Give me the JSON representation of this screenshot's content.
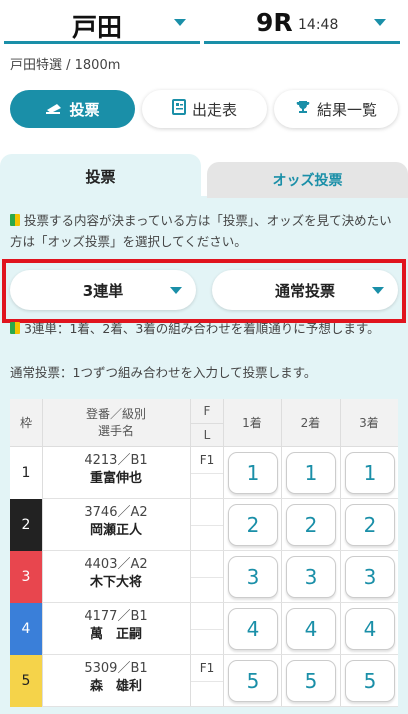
{
  "header": {
    "venue": "戸田",
    "race": "9R",
    "time": "14:48",
    "race_info": "戸田特選 / 1800m"
  },
  "nav": {
    "vote": "投票",
    "entries": "出走表",
    "results": "結果一覧"
  },
  "tabs": {
    "vote": "投票",
    "odds_vote": "オッズ投票"
  },
  "notes": {
    "intro": "投票する内容が決まっている方は「投票」、オッズを見て決めたい方は「オッズ投票」を選択してください。",
    "sanrentan": "3連単：1着、2着、3着の組み合わせを着順通りに予想します。",
    "normal": "通常投票：1つずつ組み合わせを入力して投票します。"
  },
  "selects": {
    "bet_type": "3連単",
    "vote_method": "通常投票"
  },
  "table": {
    "headers": {
      "waku": "枠",
      "player": "登番／級別\n選手名",
      "f": "F",
      "l": "L",
      "first": "1着",
      "second": "2着",
      "third": "3着"
    },
    "rows": [
      {
        "waku": "1",
        "reg": "4213／B1",
        "name": "重富伸也",
        "f": "F1",
        "color": "#ffffff",
        "text": "#222222"
      },
      {
        "waku": "2",
        "reg": "3746／A2",
        "name": "岡瀬正人",
        "f": "",
        "color": "#222222",
        "text": "#ffffff"
      },
      {
        "waku": "3",
        "reg": "4403／A2",
        "name": "木下大将",
        "f": "",
        "color": "#e8464e",
        "text": "#ffffff"
      },
      {
        "waku": "4",
        "reg": "4177／B1",
        "name": "萬　正嗣",
        "f": "",
        "color": "#3a7fd9",
        "text": "#ffffff"
      },
      {
        "waku": "5",
        "reg": "5309／B1",
        "name": "森　雄利",
        "f": "F1",
        "color": "#f5d34a",
        "text": "#222222"
      }
    ]
  },
  "colors": {
    "accent": "#1a8fa8",
    "highlight_border": "#e0141e"
  }
}
